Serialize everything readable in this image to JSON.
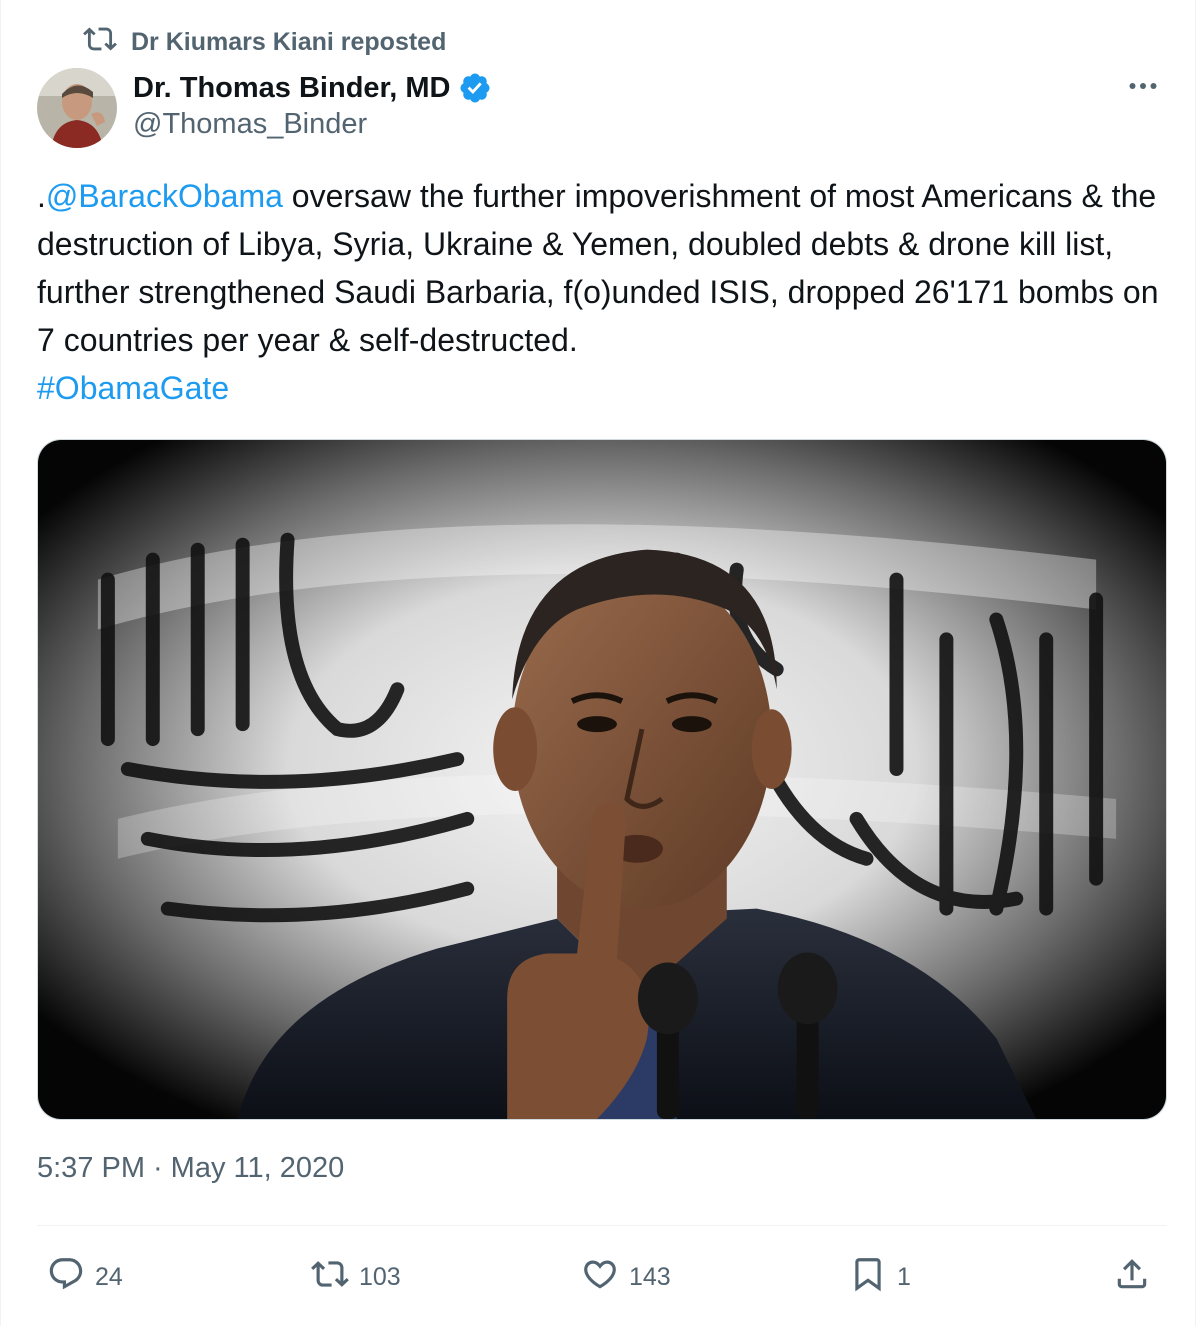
{
  "repost": {
    "icon": "repost-icon",
    "label": "Dr Kiumars Kiani reposted"
  },
  "author": {
    "name": "Dr. Thomas Binder, MD",
    "handle": "@Thomas_Binder",
    "verified": true,
    "verified_color": "#1d9bf0"
  },
  "tweet": {
    "mention": "@BarackObama",
    "body": "oversaw the further impoverishment of most Americans & the destruction of Libya, Syria, Ukraine & Yemen, doubled debts & drone kill list, further strengthened Saudi Barbaria, f(o)unded ISIS, dropped 26'171 bombs on 7 countries per year & self-destructed.",
    "hashtag": "#ObamaGate"
  },
  "meta": {
    "time": "5:37 PM",
    "separator": "·",
    "date": "May 11, 2020"
  },
  "actions": {
    "replies": "24",
    "reposts": "103",
    "likes": "143",
    "bookmarks": "1"
  },
  "colors": {
    "link": "#1d9bf0",
    "secondary_text": "#536471",
    "primary_text": "#0f1419",
    "divider": "#eff3f4"
  }
}
